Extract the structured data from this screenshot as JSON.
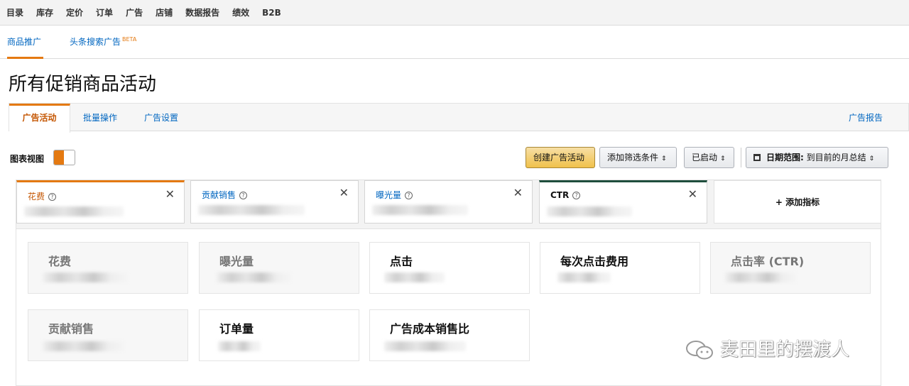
{
  "topnav": [
    "目录",
    "库存",
    "定价",
    "订单",
    "广告",
    "店铺",
    "数据报告",
    "绩效",
    "B2B"
  ],
  "subnav": {
    "active": "商品推广",
    "second": "头条搜索广告",
    "beta": "BETA"
  },
  "page_title": "所有促销商品活动",
  "tabs": {
    "campaigns": "广告活动",
    "bulk": "批量操作",
    "settings": "广告设置",
    "report": "广告报告"
  },
  "toolbar": {
    "chart_view": "图表视图",
    "create": "创建广告活动",
    "add_filter": "添加筛选条件",
    "status": "已启动",
    "date_label": "日期范围:",
    "date_value": "到目前的月总结"
  },
  "metric_cards": [
    {
      "label": "花费",
      "color": "#e47911"
    },
    {
      "label": "贡献销售",
      "color": "#ffffff"
    },
    {
      "label": "曝光量",
      "color": "#ffffff"
    },
    {
      "label": "CTR",
      "color": "#1f4e3d"
    }
  ],
  "add_metric": "+ 添加指标",
  "selectors": [
    "花费",
    "曝光量",
    "点击",
    "每次点击费用",
    "点击率 (CTR)",
    "贡献销售",
    "订单量",
    "广告成本销售比"
  ],
  "watermark": "麦田里的摆渡人"
}
